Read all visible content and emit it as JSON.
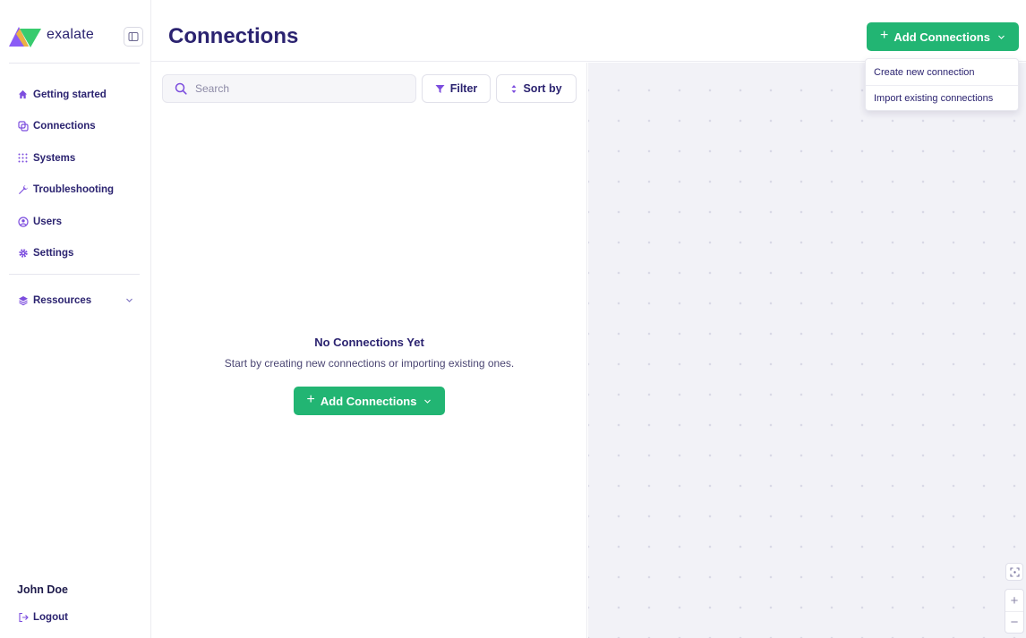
{
  "brand": {
    "name": "exalate"
  },
  "nav": [
    {
      "label": "Getting started",
      "icon": "home-icon"
    },
    {
      "label": "Connections",
      "icon": "connections-icon"
    },
    {
      "label": "Systems",
      "icon": "grid-dots-icon"
    },
    {
      "label": "Troubleshooting",
      "icon": "wrench-icon"
    },
    {
      "label": "Users",
      "icon": "user-circle-icon"
    },
    {
      "label": "Settings",
      "icon": "gear-icon"
    }
  ],
  "resources": {
    "label": "Ressources",
    "icon": "layers-icon"
  },
  "user": {
    "name": "John Doe",
    "logout_label": "Logout"
  },
  "header": {
    "title": "Connections",
    "add_button_label": "Add Connections"
  },
  "dropdown": {
    "items": [
      "Create new connection",
      "Import existing connections"
    ]
  },
  "list": {
    "search_placeholder": "Search",
    "filter_label": "Filter",
    "sort_label": "Sort by"
  },
  "empty_state": {
    "title": "No Connections Yet",
    "subtitle": "Start by creating new connections or importing existing ones.",
    "add_button_label": "Add Connections"
  },
  "canvas": {
    "zoom_in": "+",
    "zoom_out": "−"
  },
  "colors": {
    "accent": "#22b573",
    "brand_text": "#2b2370",
    "icon": "#7c4dde",
    "canvas_bg": "#f2f2f7"
  }
}
